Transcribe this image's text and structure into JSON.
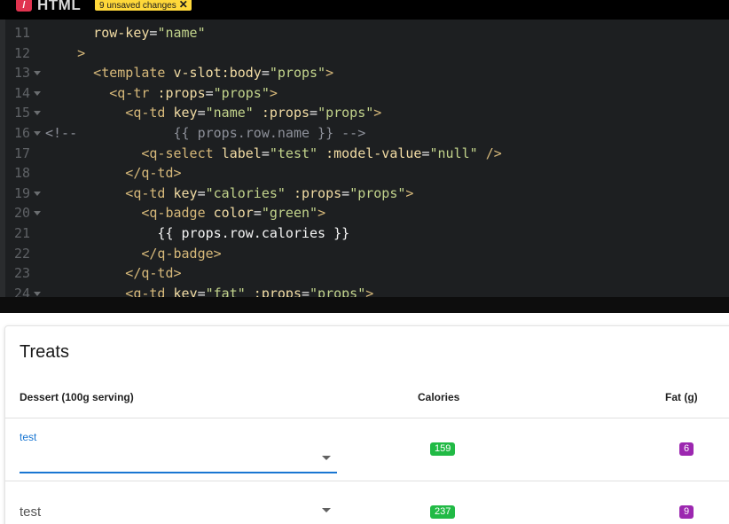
{
  "editor": {
    "language_logo": "/",
    "language": "HTML",
    "unsaved_label": "9 unsaved changes",
    "unsaved_close": "✕",
    "lines": [
      {
        "num": "11",
        "fold": false,
        "tokens": [
          {
            "t": "a",
            "v": "      row-key"
          },
          {
            "t": "p",
            "v": "="
          },
          {
            "t": "s",
            "v": "\"name\""
          }
        ]
      },
      {
        "num": "12",
        "fold": false,
        "tokens": [
          {
            "t": "t",
            "v": "    >"
          }
        ]
      },
      {
        "num": "13",
        "fold": true,
        "tokens": [
          {
            "t": "t",
            "v": "      <template "
          },
          {
            "t": "a",
            "v": "v-slot:body"
          },
          {
            "t": "p",
            "v": "="
          },
          {
            "t": "s",
            "v": "\"props\""
          },
          {
            "t": "t",
            "v": ">"
          }
        ]
      },
      {
        "num": "14",
        "fold": true,
        "tokens": [
          {
            "t": "t",
            "v": "        <q-tr "
          },
          {
            "t": "a",
            "v": ":props"
          },
          {
            "t": "p",
            "v": "="
          },
          {
            "t": "s",
            "v": "\"props\""
          },
          {
            "t": "t",
            "v": ">"
          }
        ]
      },
      {
        "num": "15",
        "fold": true,
        "tokens": [
          {
            "t": "t",
            "v": "          <q-td "
          },
          {
            "t": "a",
            "v": "key"
          },
          {
            "t": "p",
            "v": "="
          },
          {
            "t": "s",
            "v": "\"name\""
          },
          {
            "t": "a",
            "v": " :props"
          },
          {
            "t": "p",
            "v": "="
          },
          {
            "t": "s",
            "v": "\"props\""
          },
          {
            "t": "t",
            "v": ">"
          }
        ]
      },
      {
        "num": "16",
        "fold": true,
        "tokens": [
          {
            "t": "c",
            "v": "<!--            {{ props.row.name }} -->"
          }
        ]
      },
      {
        "num": "17",
        "fold": false,
        "tokens": [
          {
            "t": "t",
            "v": "            <q-select "
          },
          {
            "t": "a",
            "v": "label"
          },
          {
            "t": "p",
            "v": "="
          },
          {
            "t": "s",
            "v": "\"test\""
          },
          {
            "t": "a",
            "v": " :model-value"
          },
          {
            "t": "p",
            "v": "="
          },
          {
            "t": "s",
            "v": "\"null\""
          },
          {
            "t": "t",
            "v": " />"
          }
        ]
      },
      {
        "num": "18",
        "fold": false,
        "tokens": [
          {
            "t": "t",
            "v": "          </q-td>"
          }
        ]
      },
      {
        "num": "19",
        "fold": true,
        "tokens": [
          {
            "t": "t",
            "v": "          <q-td "
          },
          {
            "t": "a",
            "v": "key"
          },
          {
            "t": "p",
            "v": "="
          },
          {
            "t": "s",
            "v": "\"calories\""
          },
          {
            "t": "a",
            "v": " :props"
          },
          {
            "t": "p",
            "v": "="
          },
          {
            "t": "s",
            "v": "\"props\""
          },
          {
            "t": "t",
            "v": ">"
          }
        ]
      },
      {
        "num": "20",
        "fold": true,
        "tokens": [
          {
            "t": "t",
            "v": "            <q-badge "
          },
          {
            "t": "a",
            "v": "color"
          },
          {
            "t": "p",
            "v": "="
          },
          {
            "t": "s",
            "v": "\"green\""
          },
          {
            "t": "t",
            "v": ">"
          }
        ]
      },
      {
        "num": "21",
        "fold": false,
        "tokens": [
          {
            "t": "m",
            "v": "              {{ props.row.calories }}"
          }
        ]
      },
      {
        "num": "22",
        "fold": false,
        "tokens": [
          {
            "t": "t",
            "v": "            </q-badge>"
          }
        ]
      },
      {
        "num": "23",
        "fold": false,
        "tokens": [
          {
            "t": "t",
            "v": "          </q-td>"
          }
        ]
      },
      {
        "num": "24",
        "fold": true,
        "tokens": [
          {
            "t": "t",
            "v": "          <q-td "
          },
          {
            "t": "a",
            "v": "key"
          },
          {
            "t": "p",
            "v": "="
          },
          {
            "t": "s",
            "v": "\"fat\""
          },
          {
            "t": "a",
            "v": " :props"
          },
          {
            "t": "p",
            "v": "="
          },
          {
            "t": "s",
            "v": "\"props\""
          },
          {
            "t": "t",
            "v": ">"
          }
        ]
      }
    ]
  },
  "table": {
    "title": "Treats",
    "columns": {
      "dessert": "Dessert (100g serving)",
      "calories": "Calories",
      "fat": "Fat (g)"
    },
    "rows": [
      {
        "select_label": "test",
        "focused": true,
        "calories": "159",
        "fat": "6"
      },
      {
        "select_label": "test",
        "focused": false,
        "calories": "237",
        "fat": "9"
      }
    ],
    "colors": {
      "calories_badge": "#21ba45",
      "fat_badge": "#9c27b0",
      "focus": "#1976d2"
    }
  }
}
